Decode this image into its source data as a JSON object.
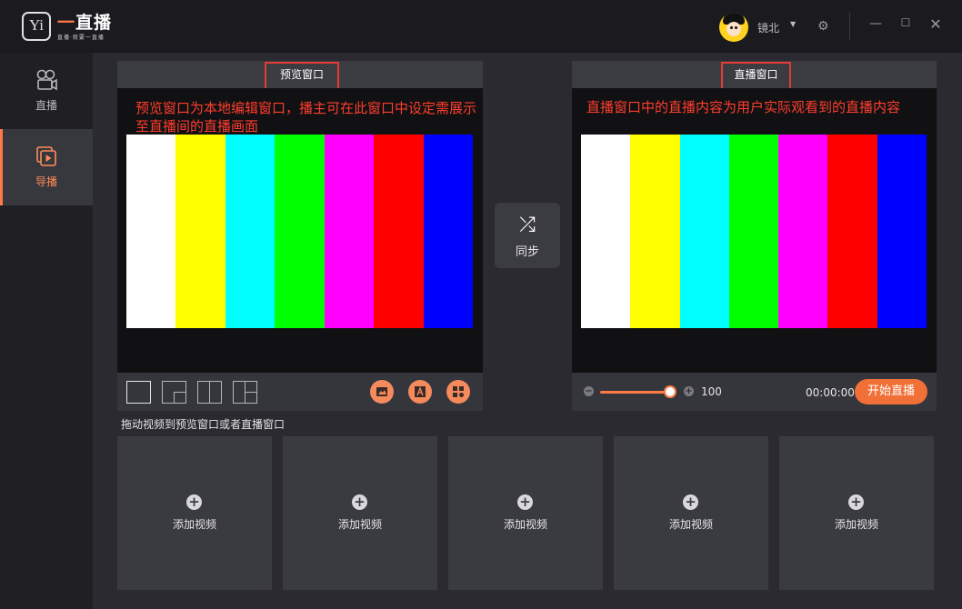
{
  "app": {
    "logo_glyph": "Yi",
    "name_prefix": "一",
    "name_rest": "直播",
    "tagline": "直播·就要一直播"
  },
  "user": {
    "name": "镜北",
    "dropdown_icon": "caret-down-icon"
  },
  "window_controls": {
    "settings_icon": "gear-icon",
    "minimize": "—",
    "maximize": "☐",
    "close": "✕"
  },
  "sidebar": {
    "items": [
      {
        "label": "直播",
        "icon": "camera-icon",
        "active": false
      },
      {
        "label": "导播",
        "icon": "play-icon",
        "active": true
      }
    ]
  },
  "preview": {
    "title": "预览窗口",
    "annotation": "预览窗口为本地编辑窗口，播主可在此窗口中设定需展示至直播间的直播画面"
  },
  "live": {
    "title": "直播窗口",
    "annotation": "直播窗口中的直播内容为用户实际观看到的直播内容"
  },
  "color_bars": [
    "#ffffff",
    "#ffff00",
    "#00ffff",
    "#00ff00",
    "#ff00ff",
    "#ff0000",
    "#0000ff"
  ],
  "sync": {
    "label": "同步",
    "icon": "shuffle-icon"
  },
  "controls": {
    "volume_value": "100",
    "volume_fraction": 0.9,
    "time": "00:00:00",
    "start_label": "开始直播"
  },
  "drag_hint": "拖动视频到预览窗口或者直播窗口",
  "slots": [
    {
      "label": "添加视频"
    },
    {
      "label": "添加视频"
    },
    {
      "label": "添加视频"
    },
    {
      "label": "添加视频"
    },
    {
      "label": "添加视频"
    }
  ],
  "accent_color": "#ff7a45"
}
